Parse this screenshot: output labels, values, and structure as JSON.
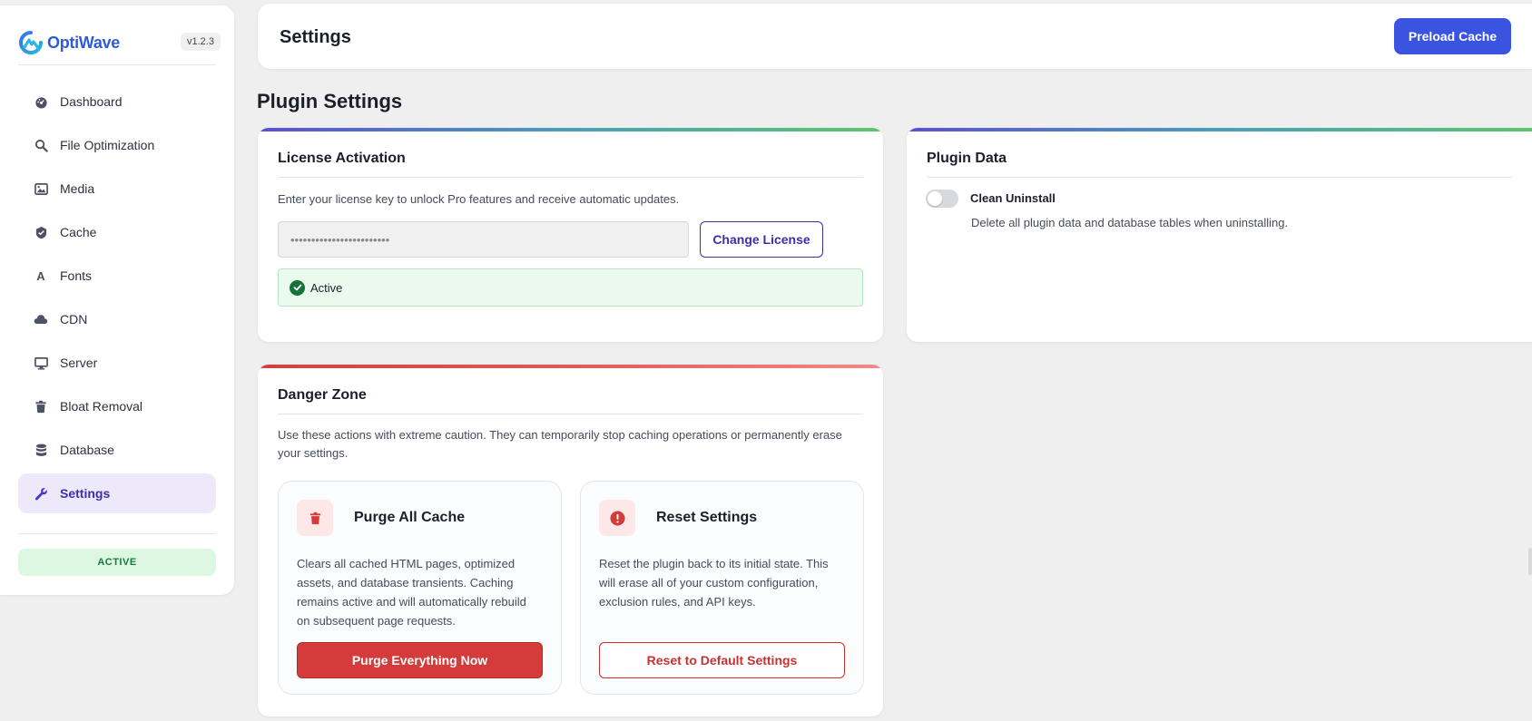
{
  "brand": {
    "name": "OptiWave",
    "version": "v1.2.3"
  },
  "sidebar": {
    "items": [
      {
        "label": "Dashboard",
        "icon": "dashboard-icon"
      },
      {
        "label": "File Optimization",
        "icon": "magnifier-icon"
      },
      {
        "label": "Media",
        "icon": "image-icon"
      },
      {
        "label": "Cache",
        "icon": "cache-icon"
      },
      {
        "label": "Fonts",
        "icon": "font-icon"
      },
      {
        "label": "CDN",
        "icon": "cloud-icon"
      },
      {
        "label": "Server",
        "icon": "monitor-icon"
      },
      {
        "label": "Bloat Removal",
        "icon": "trash-icon"
      },
      {
        "label": "Database",
        "icon": "database-icon"
      },
      {
        "label": "Settings",
        "icon": "wrench-icon",
        "active": true
      }
    ],
    "status": "ACTIVE"
  },
  "header": {
    "title": "Settings",
    "preload_button": "Preload Cache"
  },
  "section_title": "Plugin Settings",
  "license": {
    "title": "License Activation",
    "description": "Enter your license key to unlock Pro features and receive automatic updates.",
    "key_value": "••••••••••••••••••••••••",
    "change_button": "Change License",
    "status": "Active"
  },
  "plugin_data": {
    "title": "Plugin Data",
    "toggle_label": "Clean Uninstall",
    "toggle_on": false,
    "toggle_description": "Delete all plugin data and database tables when uninstalling."
  },
  "danger": {
    "title": "Danger Zone",
    "description_line1": "Use these actions with extreme caution. They can temporarily stop caching operations or permanently erase",
    "description_line2": "your settings.",
    "purge": {
      "title": "Purge All Cache",
      "description": "Clears all cached HTML pages, optimized assets, and database transients. Caching remains active and will automatically rebuild on subsequent page requests.",
      "button": "Purge Everything Now"
    },
    "reset": {
      "title": "Reset Settings",
      "description": "Reset the plugin back to its initial state. This will erase all of your custom configuration, exclusion rules, and API keys.",
      "button": "Reset to Default Settings"
    }
  },
  "colors": {
    "accent": "#3a53e0",
    "active_nav": "#3d2fa8",
    "danger": "#d43b3b",
    "success": "#18703a"
  }
}
